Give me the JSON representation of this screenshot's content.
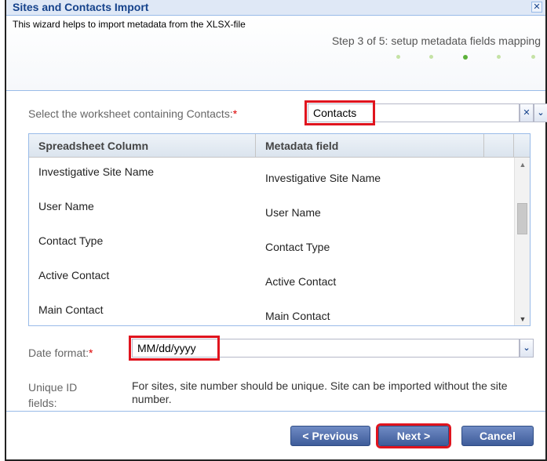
{
  "dialog": {
    "title": "Sites and Contacts Import",
    "close_icon": "close-icon",
    "intro": "This wizard helps to import metadata from the XLSX-file",
    "step": "Step 3 of 5: setup metadata fields mapping",
    "steps_total": 5,
    "current_step": 3
  },
  "worksheet": {
    "label": "Select the worksheet containing Contacts:",
    "required_mark": "*",
    "value": "Contacts",
    "clear_icon": "clear-icon",
    "dropdown_icon": "chevron-down-icon"
  },
  "grid": {
    "columns": [
      "Spreadsheet Column",
      "Metadata field"
    ],
    "rows": [
      {
        "column": "Investigative Site Name",
        "field": "Investigative Site Name"
      },
      {
        "column": "User Name",
        "field": "User Name"
      },
      {
        "column": "Contact Type",
        "field": "Contact Type"
      },
      {
        "column": "Active Contact",
        "field": "Active Contact"
      },
      {
        "column": "Main Contact",
        "field": "Main Contact"
      }
    ]
  },
  "date_format": {
    "label": "Date format:",
    "required_mark": "*",
    "value": "MM/dd/yyyy",
    "dropdown_icon": "chevron-down-icon"
  },
  "unique_id": {
    "label": "Unique ID fields:",
    "description": "For sites, site number should be unique. Site can be imported without the site number."
  },
  "buttons": {
    "previous": "< Previous",
    "next": "Next >",
    "cancel": "Cancel"
  },
  "colors": {
    "title": "#15428b",
    "highlight": "#e0141e",
    "button": "#3e5c9a",
    "step_dot_active": "#5cb13a",
    "step_dot": "#c5e2a5"
  }
}
